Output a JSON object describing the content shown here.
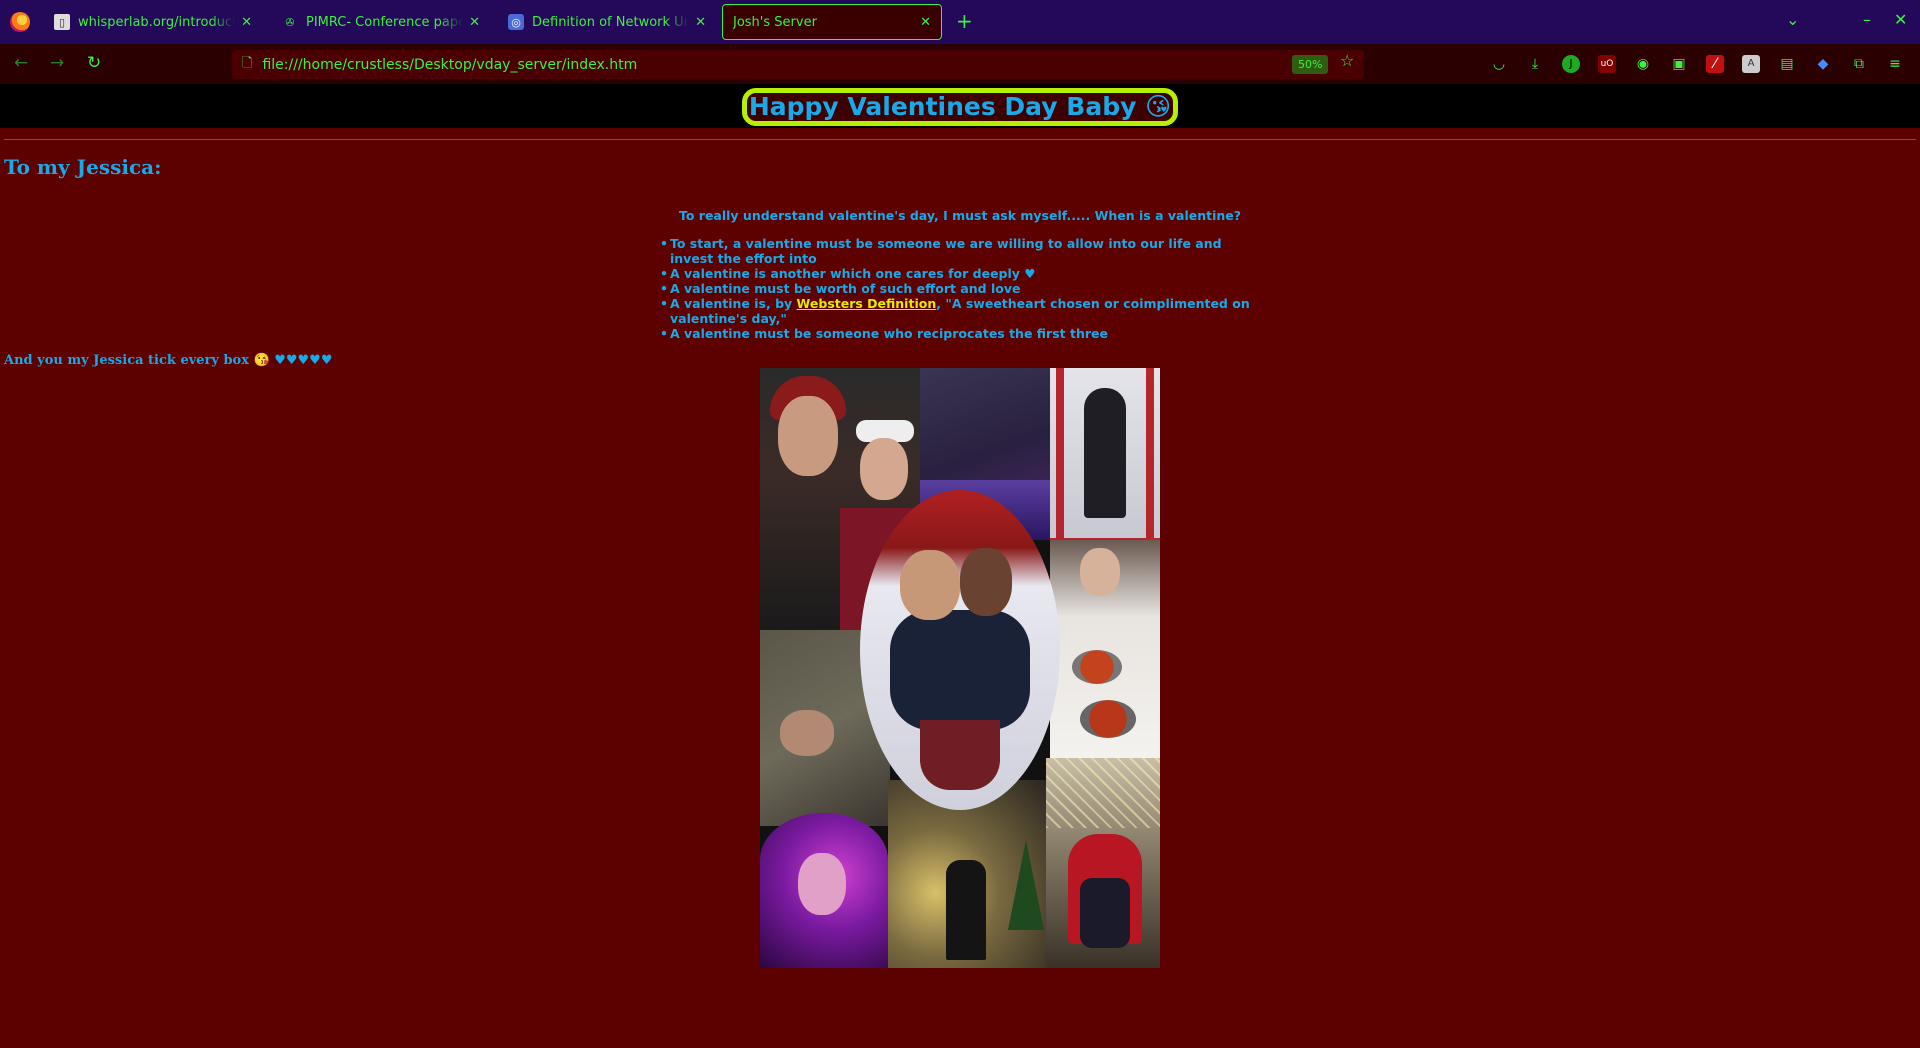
{
  "browser": {
    "tabs": [
      {
        "label": "whisperlab.org/introduction",
        "favicon": "page-icon",
        "active": false
      },
      {
        "label": "PIMRC- Conference paper - ",
        "favicon": "pin-icon",
        "active": false
      },
      {
        "label": "Definition of Network Units",
        "favicon": "globe-icon",
        "active": false
      },
      {
        "label": "Josh's Server",
        "favicon": "",
        "active": true
      }
    ],
    "url": "file:///home/crustless/Desktop/vday_server/index.htm",
    "zoom": "50%",
    "accent_color": "#3ef13e",
    "tabbar_color": "#24085a"
  },
  "page": {
    "title": "Happy Valentines Day Baby 😘",
    "greeting": "To my Jessica:",
    "question": "To really understand valentine's day, I must ask myself..... When is a valentine?",
    "criteria": [
      "To start, a valentine must be someone we are willing to allow into our life and invest the effort into",
      "A valentine is another which one cares for deeply ♥",
      "A valentine must be worth of such effort and love",
      {
        "before": "A valentine is, by ",
        "link": "Websters Definition",
        "after": ", \"A sweetheart chosen or coimplimented on valentine's day,\""
      },
      "A valentine must be someone who reciprocates the first three"
    ],
    "closing": "And you my Jessica tick every box 😘 ♥♥♥♥♥",
    "colors": {
      "background": "#5c0000",
      "text": "#19a9e8",
      "link": "#e8e800",
      "title_border": "#b6f000",
      "divider": "#8a2be2"
    }
  }
}
